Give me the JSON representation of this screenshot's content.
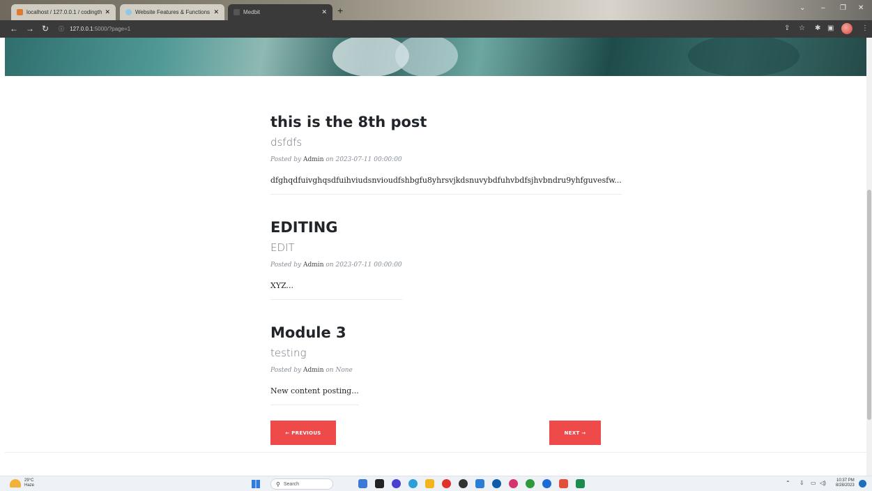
{
  "browser": {
    "tabs": [
      {
        "label": "localhost / 127.0.0.1 / codingthu",
        "close": "✕",
        "color": "#e07a2e"
      },
      {
        "label": "Website Features & Functions",
        "close": "✕",
        "color": "#8fc9e6"
      },
      {
        "label": "Medbit",
        "close": "✕",
        "color": "#777777"
      }
    ],
    "new_tab": "+",
    "url": {
      "host": "127.0.0.1",
      "rest": ":5000/?page=1",
      "info_icon": "ⓘ"
    },
    "window_controls": {
      "chevron": "⌄",
      "minimize": "–",
      "restore": "❐",
      "close": "✕"
    }
  },
  "posts": [
    {
      "title": "this is the 8th post",
      "subtitle": "dsfdfs",
      "posted_by": "Posted by",
      "author": "Admin",
      "on": "on",
      "date": "2023-07-11 00:00:00",
      "excerpt": "dfghqdfuivghqsdfuihviudsnvioudfshbgfu8yhrsvjkdsnuvybdfuhvbdfsjhvbndru9yhfguvesfw..."
    },
    {
      "title": "EDITING",
      "subtitle": "EDIT",
      "posted_by": "Posted by",
      "author": "Admin",
      "on": "on",
      "date": "2023-07-11 00:00:00",
      "excerpt": "XYZ..."
    },
    {
      "title": "Module 3",
      "subtitle": "testing",
      "posted_by": "Posted by",
      "author": "Admin",
      "on": "on",
      "date": "None",
      "excerpt": "New content posting..."
    }
  ],
  "pagination": {
    "previous": "← PREVIOUS",
    "next": "NEXT →"
  },
  "taskbar": {
    "weather": {
      "temp": "29°C",
      "condition": "Haze"
    },
    "search_placeholder": "Search",
    "clock": {
      "time": "10:37 PM",
      "date": "8/28/2023"
    }
  },
  "colors": {
    "accent_button": "#ef4a4a",
    "title": "#212529",
    "meta": "#868e96"
  }
}
